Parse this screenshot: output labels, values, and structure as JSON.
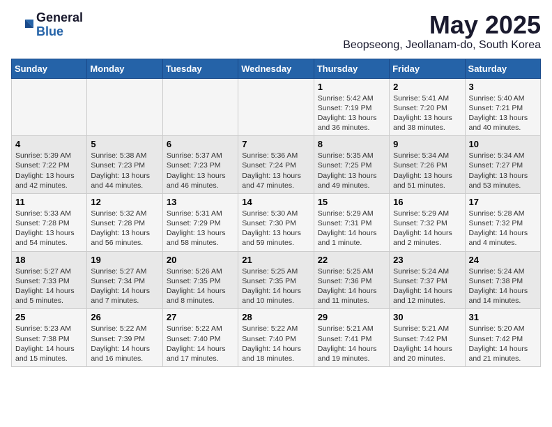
{
  "header": {
    "logo_general": "General",
    "logo_blue": "Blue",
    "month": "May 2025",
    "location": "Beopseong, Jeollanam-do, South Korea"
  },
  "days_of_week": [
    "Sunday",
    "Monday",
    "Tuesday",
    "Wednesday",
    "Thursday",
    "Friday",
    "Saturday"
  ],
  "weeks": [
    [
      {
        "day": "",
        "data": ""
      },
      {
        "day": "",
        "data": ""
      },
      {
        "day": "",
        "data": ""
      },
      {
        "day": "",
        "data": ""
      },
      {
        "day": "1",
        "data": "Sunrise: 5:42 AM\nSunset: 7:19 PM\nDaylight: 13 hours\nand 36 minutes."
      },
      {
        "day": "2",
        "data": "Sunrise: 5:41 AM\nSunset: 7:20 PM\nDaylight: 13 hours\nand 38 minutes."
      },
      {
        "day": "3",
        "data": "Sunrise: 5:40 AM\nSunset: 7:21 PM\nDaylight: 13 hours\nand 40 minutes."
      }
    ],
    [
      {
        "day": "4",
        "data": "Sunrise: 5:39 AM\nSunset: 7:22 PM\nDaylight: 13 hours\nand 42 minutes."
      },
      {
        "day": "5",
        "data": "Sunrise: 5:38 AM\nSunset: 7:23 PM\nDaylight: 13 hours\nand 44 minutes."
      },
      {
        "day": "6",
        "data": "Sunrise: 5:37 AM\nSunset: 7:23 PM\nDaylight: 13 hours\nand 46 minutes."
      },
      {
        "day": "7",
        "data": "Sunrise: 5:36 AM\nSunset: 7:24 PM\nDaylight: 13 hours\nand 47 minutes."
      },
      {
        "day": "8",
        "data": "Sunrise: 5:35 AM\nSunset: 7:25 PM\nDaylight: 13 hours\nand 49 minutes."
      },
      {
        "day": "9",
        "data": "Sunrise: 5:34 AM\nSunset: 7:26 PM\nDaylight: 13 hours\nand 51 minutes."
      },
      {
        "day": "10",
        "data": "Sunrise: 5:34 AM\nSunset: 7:27 PM\nDaylight: 13 hours\nand 53 minutes."
      }
    ],
    [
      {
        "day": "11",
        "data": "Sunrise: 5:33 AM\nSunset: 7:28 PM\nDaylight: 13 hours\nand 54 minutes."
      },
      {
        "day": "12",
        "data": "Sunrise: 5:32 AM\nSunset: 7:28 PM\nDaylight: 13 hours\nand 56 minutes."
      },
      {
        "day": "13",
        "data": "Sunrise: 5:31 AM\nSunset: 7:29 PM\nDaylight: 13 hours\nand 58 minutes."
      },
      {
        "day": "14",
        "data": "Sunrise: 5:30 AM\nSunset: 7:30 PM\nDaylight: 13 hours\nand 59 minutes."
      },
      {
        "day": "15",
        "data": "Sunrise: 5:29 AM\nSunset: 7:31 PM\nDaylight: 14 hours\nand 1 minute."
      },
      {
        "day": "16",
        "data": "Sunrise: 5:29 AM\nSunset: 7:32 PM\nDaylight: 14 hours\nand 2 minutes."
      },
      {
        "day": "17",
        "data": "Sunrise: 5:28 AM\nSunset: 7:32 PM\nDaylight: 14 hours\nand 4 minutes."
      }
    ],
    [
      {
        "day": "18",
        "data": "Sunrise: 5:27 AM\nSunset: 7:33 PM\nDaylight: 14 hours\nand 5 minutes."
      },
      {
        "day": "19",
        "data": "Sunrise: 5:27 AM\nSunset: 7:34 PM\nDaylight: 14 hours\nand 7 minutes."
      },
      {
        "day": "20",
        "data": "Sunrise: 5:26 AM\nSunset: 7:35 PM\nDaylight: 14 hours\nand 8 minutes."
      },
      {
        "day": "21",
        "data": "Sunrise: 5:25 AM\nSunset: 7:35 PM\nDaylight: 14 hours\nand 10 minutes."
      },
      {
        "day": "22",
        "data": "Sunrise: 5:25 AM\nSunset: 7:36 PM\nDaylight: 14 hours\nand 11 minutes."
      },
      {
        "day": "23",
        "data": "Sunrise: 5:24 AM\nSunset: 7:37 PM\nDaylight: 14 hours\nand 12 minutes."
      },
      {
        "day": "24",
        "data": "Sunrise: 5:24 AM\nSunset: 7:38 PM\nDaylight: 14 hours\nand 14 minutes."
      }
    ],
    [
      {
        "day": "25",
        "data": "Sunrise: 5:23 AM\nSunset: 7:38 PM\nDaylight: 14 hours\nand 15 minutes."
      },
      {
        "day": "26",
        "data": "Sunrise: 5:22 AM\nSunset: 7:39 PM\nDaylight: 14 hours\nand 16 minutes."
      },
      {
        "day": "27",
        "data": "Sunrise: 5:22 AM\nSunset: 7:40 PM\nDaylight: 14 hours\nand 17 minutes."
      },
      {
        "day": "28",
        "data": "Sunrise: 5:22 AM\nSunset: 7:40 PM\nDaylight: 14 hours\nand 18 minutes."
      },
      {
        "day": "29",
        "data": "Sunrise: 5:21 AM\nSunset: 7:41 PM\nDaylight: 14 hours\nand 19 minutes."
      },
      {
        "day": "30",
        "data": "Sunrise: 5:21 AM\nSunset: 7:42 PM\nDaylight: 14 hours\nand 20 minutes."
      },
      {
        "day": "31",
        "data": "Sunrise: 5:20 AM\nSunset: 7:42 PM\nDaylight: 14 hours\nand 21 minutes."
      }
    ]
  ]
}
